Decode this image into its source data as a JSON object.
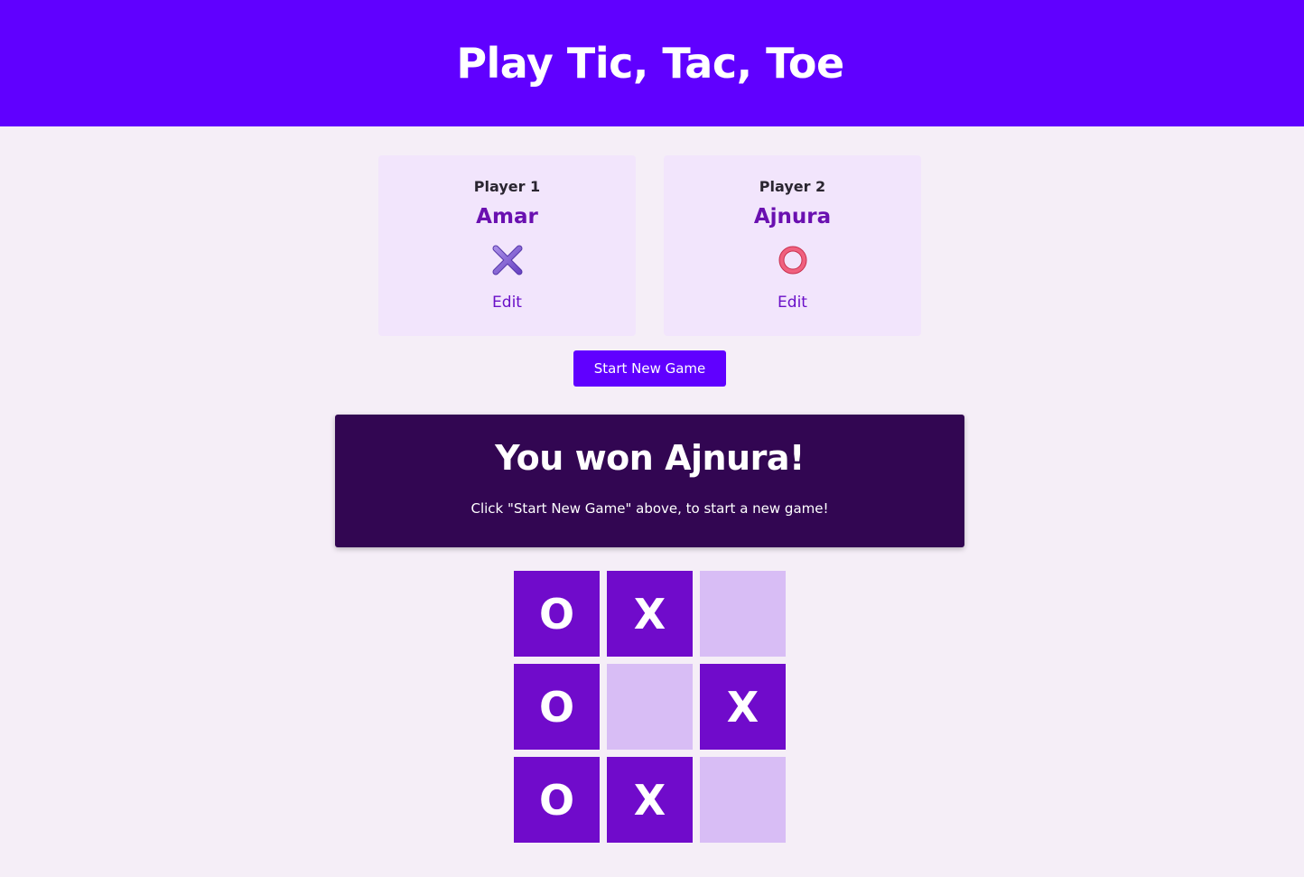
{
  "header": {
    "title": "Play Tic, Tac, Toe"
  },
  "players": [
    {
      "label": "Player 1",
      "name": "Amar",
      "symbol_icon": "cross-mark-icon",
      "edit_label": "Edit"
    },
    {
      "label": "Player 2",
      "name": "Ajnura",
      "symbol_icon": "hollow-circle-icon",
      "edit_label": "Edit"
    }
  ],
  "controls": {
    "start_label": "Start New Game"
  },
  "result": {
    "title": "You won Ajnura!",
    "message": "Click \"Start New Game\" above, to start a new game!"
  },
  "board": {
    "cells": [
      "O",
      "X",
      "",
      "O",
      "",
      "X",
      "O",
      "X",
      ""
    ]
  },
  "colors": {
    "header_bg": "#6000ff",
    "page_bg": "#f5eef7",
    "card_bg": "#f2e5fc",
    "result_bg": "#320652",
    "cell_filled": "#700bcb",
    "cell_empty": "#d8bdf5"
  }
}
